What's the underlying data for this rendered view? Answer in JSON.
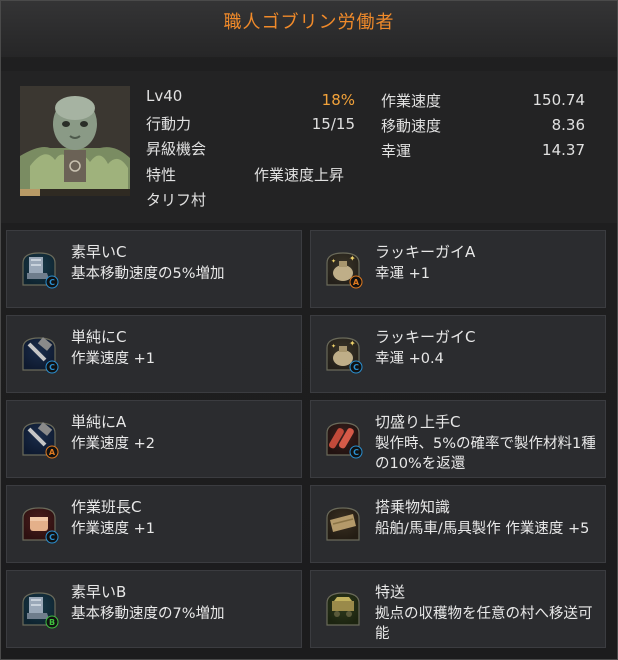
{
  "window": {
    "title": "職人ゴブリン労働者"
  },
  "profile": {
    "level": "Lv40",
    "exp": "18%",
    "exp_fraction": 0.18,
    "stamina_label": "行動力",
    "stamina_value": "15/15",
    "promotion_label": "昇級機会",
    "trait_label": "特性",
    "trait_value": "作業速度上昇",
    "town": "タリフ村",
    "work_speed_label": "作業速度",
    "work_speed_value": "150.74",
    "move_speed_label": "移動速度",
    "move_speed_value": "8.36",
    "luck_label": "幸運",
    "luck_value": "14.37"
  },
  "skills": [
    {
      "name": "素早いC",
      "desc": "基本移動速度の5%増加",
      "icon": "boot-icon",
      "grade": "C",
      "col": "left"
    },
    {
      "name": "ラッキーガイA",
      "desc": "幸運 +1",
      "icon": "lucky-bag-icon",
      "grade": "A",
      "col": "right"
    },
    {
      "name": "単純にC",
      "desc": "作業速度 +1",
      "icon": "hammer-icon",
      "grade": "C",
      "col": "left"
    },
    {
      "name": "ラッキーガイC",
      "desc": "幸運 +0.4",
      "icon": "lucky-bag-icon",
      "grade": "C",
      "col": "right"
    },
    {
      "name": "単純にA",
      "desc": "作業速度 +2",
      "icon": "hammer-icon",
      "grade": "A",
      "col": "left"
    },
    {
      "name": "切盛り上手C",
      "desc": "製作時、5%の確率で製作材料1種の10%を返還",
      "icon": "materials-icon",
      "grade": "C",
      "col": "right"
    },
    {
      "name": "作業班長C",
      "desc": "作業速度 +1",
      "icon": "fist-icon",
      "grade": "C",
      "col": "left"
    },
    {
      "name": "搭乗物知識",
      "desc": "船舶/馬車/馬具製作 作業速度 +5",
      "icon": "wood-icon",
      "grade": "",
      "col": "right"
    },
    {
      "name": "素早いB",
      "desc": "基本移動速度の7%増加",
      "icon": "boot-icon",
      "grade": "B",
      "col": "left"
    },
    {
      "name": "特送",
      "desc": "拠点の収穫物を任意の村へ移送可能",
      "icon": "cart-icon",
      "grade": "",
      "col": "right"
    }
  ],
  "colors": {
    "title": "#f08a2a",
    "exp": "#f2a23a",
    "grade_c": "#2a8fd0",
    "grade_a": "#e07a20",
    "grade_b": "#3fbf3f"
  }
}
